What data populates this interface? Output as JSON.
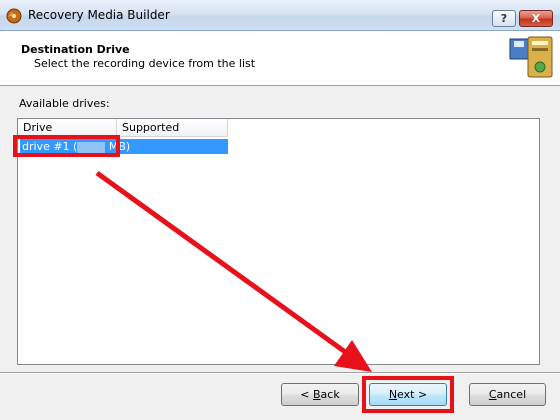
{
  "window": {
    "title": "Recovery Media Builder",
    "help_label": "?",
    "close_label": "X"
  },
  "header": {
    "title": "Destination Drive",
    "subtitle": "Select the recording device from the list"
  },
  "drives": {
    "label": "Available drives:",
    "columns": [
      "Drive",
      "Supported Formats"
    ],
    "rows": [
      {
        "drive_prefix": "drive #1 (",
        "drive_suffix": " MB)",
        "formats": "",
        "selected": true
      }
    ]
  },
  "buttons": {
    "back_arrow": "< ",
    "back_mnemonic": "B",
    "back_rest": "ack",
    "next_mnemonic": "N",
    "next_rest": "ext >",
    "cancel_mnemonic": "C",
    "cancel_rest": "ancel"
  },
  "colors": {
    "highlight": "#e8101a",
    "selection": "#3399ff"
  }
}
